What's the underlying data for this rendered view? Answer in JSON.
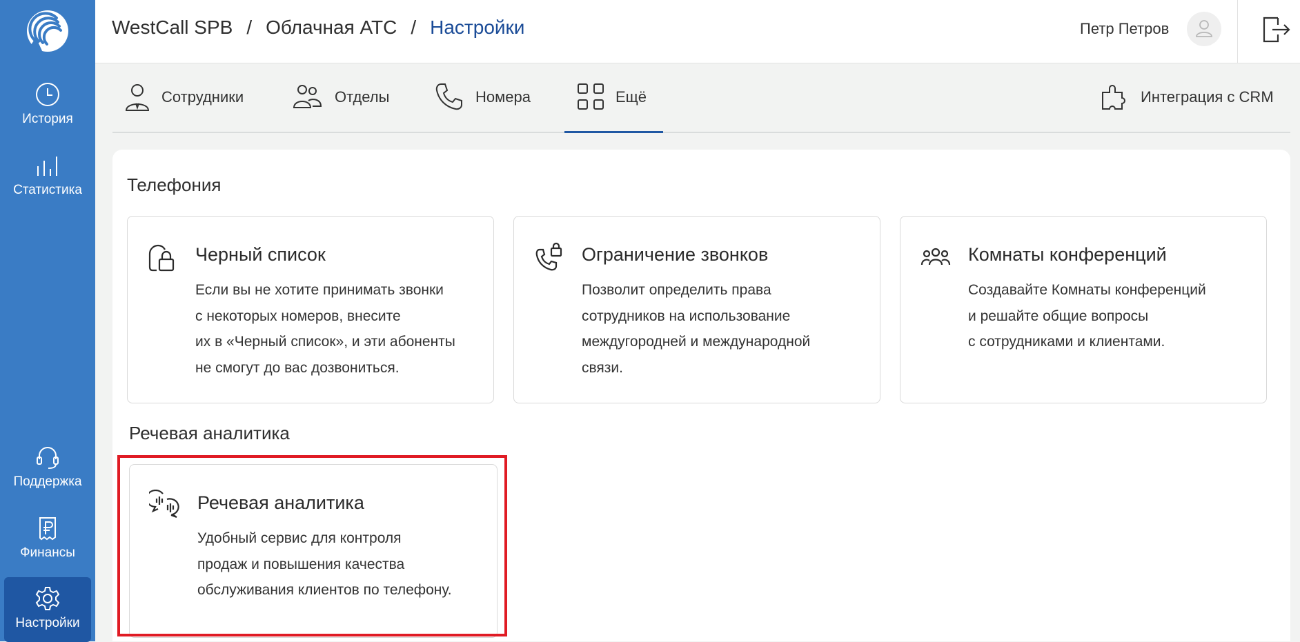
{
  "sidebar": {
    "logo_icon": "westcall-logo",
    "items": [
      {
        "label": "История",
        "icon": "clock-icon"
      },
      {
        "label": "Статистика",
        "icon": "bar-chart-icon"
      },
      {
        "label": "Поддержка",
        "icon": "headset-icon"
      },
      {
        "label": "Финансы",
        "icon": "ruble-document-icon"
      },
      {
        "label": "Настройки",
        "icon": "gear-icon",
        "active": true
      }
    ]
  },
  "header": {
    "breadcrumbs": [
      "WestCall SPB",
      "Облачная АТС",
      "Настройки"
    ],
    "separator": "/",
    "user_name": "Петр Петров",
    "avatar_icon": "user-icon",
    "logout_icon": "logout-icon"
  },
  "tabs": [
    {
      "label": "Сотрудники",
      "icon": "employee-icon"
    },
    {
      "label": "Отделы",
      "icon": "departments-icon"
    },
    {
      "label": "Номера",
      "icon": "phone-icon"
    },
    {
      "label": "Ещё",
      "icon": "grid-icon",
      "active": true
    },
    {
      "label": "Интеграция с CRM",
      "icon": "puzzle-icon"
    }
  ],
  "sections": [
    {
      "title": "Телефония",
      "cards": [
        {
          "title": "Черный список",
          "icon": "lock-phone-icon",
          "description": "Если вы не хотите принимать звонки\nс некоторых номеров, внесите\nих в «Черный список», и эти абоненты\nне смогут до вас дозвониться."
        },
        {
          "title": "Ограничение звонков",
          "icon": "phone-lock-icon",
          "description": "Позволит определить права\nсотрудников на использование\nмеждугородней и международной\nсвязи."
        },
        {
          "title": "Комнаты конференций",
          "icon": "group-icon",
          "description": "Создавайте Комнаты конференций\nи решайте общие вопросы\nс сотрудниками и клиентами."
        }
      ]
    },
    {
      "title": "Речевая аналитика",
      "cards": [
        {
          "title": "Речевая аналитика",
          "icon": "speech-analytics-icon",
          "description": "Удобный сервис для контроля\nпродаж и повышения качества\nобслуживания клиентов по телефону."
        }
      ]
    }
  ],
  "colors": {
    "sidebar_bg": "#3a7cc5",
    "sidebar_active": "#1f57a3",
    "breadcrumb_current": "#1a4b97",
    "highlight": "#e01b24"
  }
}
